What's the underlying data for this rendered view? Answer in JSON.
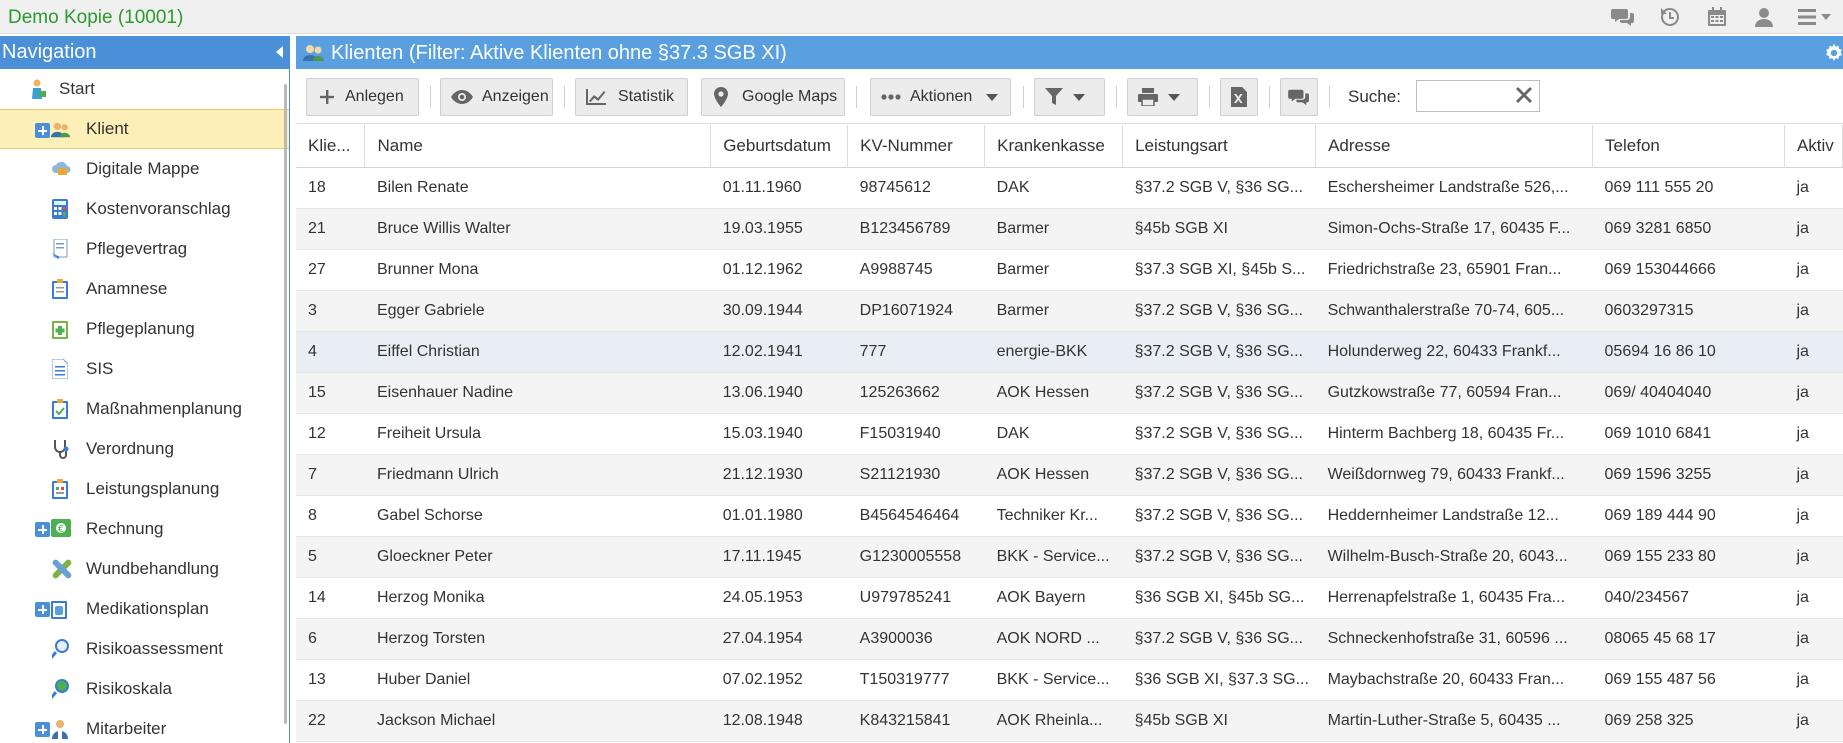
{
  "app": {
    "title": "Demo Kopie (10001)"
  },
  "top_icons": [
    "chat-icon",
    "history-icon",
    "calendar-icon",
    "user-icon",
    "menu-icon"
  ],
  "sidebar": {
    "title": "Navigation",
    "items": [
      {
        "label": "Start",
        "icon": "start-icon",
        "expandable": false,
        "active": false,
        "level": 0
      },
      {
        "label": "Klient",
        "icon": "clients-icon",
        "expandable": true,
        "active": true,
        "level": 0
      },
      {
        "label": "Digitale Mappe",
        "icon": "cloud-folder-icon",
        "expandable": false,
        "active": false,
        "level": 1
      },
      {
        "label": "Kostenvoranschlag",
        "icon": "calculator-icon",
        "expandable": false,
        "active": false,
        "level": 1
      },
      {
        "label": "Pflegevertrag",
        "icon": "contract-icon",
        "expandable": false,
        "active": false,
        "level": 1
      },
      {
        "label": "Anamnese",
        "icon": "clipboard-icon",
        "expandable": false,
        "active": false,
        "level": 1
      },
      {
        "label": "Pflegeplanung",
        "icon": "care-plan-icon",
        "expandable": false,
        "active": false,
        "level": 1
      },
      {
        "label": "SIS",
        "icon": "document-icon",
        "expandable": false,
        "active": false,
        "level": 1
      },
      {
        "label": "Maßnahmenplanung",
        "icon": "measures-icon",
        "expandable": false,
        "active": false,
        "level": 1
      },
      {
        "label": "Verordnung",
        "icon": "stethoscope-icon",
        "expandable": false,
        "active": false,
        "level": 1
      },
      {
        "label": "Leistungsplanung",
        "icon": "service-plan-icon",
        "expandable": false,
        "active": false,
        "level": 1
      },
      {
        "label": "Rechnung",
        "icon": "invoice-icon",
        "expandable": true,
        "active": false,
        "level": 0
      },
      {
        "label": "Wundbehandlung",
        "icon": "bandage-icon",
        "expandable": false,
        "active": false,
        "level": 1
      },
      {
        "label": "Medikationsplan",
        "icon": "medication-icon",
        "expandable": true,
        "active": false,
        "level": 0
      },
      {
        "label": "Risikoassessment",
        "icon": "risk-magnifier-icon",
        "expandable": false,
        "active": false,
        "level": 1
      },
      {
        "label": "Risikoskala",
        "icon": "risk-scale-icon",
        "expandable": false,
        "active": false,
        "level": 1
      },
      {
        "label": "Mitarbeiter",
        "icon": "employee-icon",
        "expandable": true,
        "active": false,
        "level": 0
      }
    ]
  },
  "main": {
    "title": "Klienten (Filter: Aktive Klienten ohne §37.3 SGB XI)"
  },
  "toolbar": {
    "add_label": "Anlegen",
    "view_label": "Anzeigen",
    "stats_label": "Statistik",
    "maps_label": "Google Maps",
    "actions_label": "Aktionen",
    "search_label": "Suche:",
    "search_value": ""
  },
  "table": {
    "columns": [
      "Klie...",
      "Name",
      "Geburtsdatum",
      "KV-Nummer",
      "Krankenkasse",
      "Leistungsart",
      "Adresse",
      "Telefon",
      "Aktiv"
    ],
    "rows": [
      [
        "18",
        "Bilen Renate",
        "01.11.1960",
        "98745612",
        "DAK",
        "§37.2 SGB V, §36 SG...",
        "Eschersheimer Landstraße 526,...",
        "069 111 555 20",
        "ja"
      ],
      [
        "21",
        "Bruce Willis Walter",
        "19.03.1955",
        "B123456789",
        "Barmer",
        "§45b SGB XI",
        "Simon-Ochs-Straße 17, 60435 F...",
        "069 3281 6850",
        "ja"
      ],
      [
        "27",
        "Brunner Mona",
        "01.12.1962",
        "A9988745",
        "Barmer",
        "§37.3 SGB XI, §45b S...",
        "Friedrichstraße 23, 65901 Fran...",
        "069 153044666",
        "ja"
      ],
      [
        "3",
        "Egger Gabriele",
        "30.09.1944",
        "DP16071924",
        "Barmer",
        "§37.2 SGB V, §36 SG...",
        "Schwanthalerstraße 70-74, 605...",
        "0603297315",
        "ja"
      ],
      [
        "4",
        "Eiffel Christian",
        "12.02.1941",
        "777",
        "energie-BKK",
        "§37.2 SGB V, §36 SG...",
        "Holunderweg 22, 60433 Frankf...",
        "05694 16 86 10",
        "ja"
      ],
      [
        "15",
        "Eisenhauer Nadine",
        "13.06.1940",
        "125263662",
        "AOK Hessen",
        "§37.2 SGB V, §36 SG...",
        "Gutzkowstraße 77, 60594 Fran...",
        "069/ 40404040",
        "ja"
      ],
      [
        "12",
        "Freiheit Ursula",
        "15.03.1940",
        "F15031940",
        "DAK",
        "§37.2 SGB V, §36 SG...",
        "Hinterm Bachberg 18, 60435 Fr...",
        "069 1010 6841",
        "ja"
      ],
      [
        "7",
        "Friedmann Ulrich",
        "21.12.1930",
        "S21121930",
        "AOK Hessen",
        "§37.2 SGB V, §36 SG...",
        "Weißdornweg 79, 60433 Frankf...",
        "069 1596 3255",
        "ja"
      ],
      [
        "8",
        "Gabel Schorse",
        "01.01.1980",
        "B4564546464",
        "Techniker Kr...",
        "§37.2 SGB V, §36 SG...",
        "Heddernheimer Landstraße 12...",
        "069 189 444 90",
        "ja"
      ],
      [
        "5",
        "Gloeckner Peter",
        "17.11.1945",
        "G1230005558",
        "BKK - Service...",
        "§37.2 SGB V, §36 SG...",
        "Wilhelm-Busch-Straße 20, 6043...",
        "069 155 233 80",
        "ja"
      ],
      [
        "14",
        "Herzog Monika",
        "24.05.1953",
        "U979785241",
        "AOK Bayern",
        "§36 SGB XI, §45b SG...",
        "Herrenapfelstraße 1, 60435 Fra...",
        "040/234567",
        "ja"
      ],
      [
        "6",
        "Herzog Torsten",
        "27.04.1954",
        "A3900036",
        "AOK NORD ...",
        "§37.2 SGB V, §36 SG...",
        "Schneckenhofstraße 31, 60596 ...",
        "08065 45 68 17",
        "ja"
      ],
      [
        "13",
        "Huber Daniel",
        "07.02.1952",
        "T150319777",
        "BKK - Service...",
        "§36 SGB XI, §37.3 SG...",
        "Maybachstraße 20, 60433 Fran...",
        "069 155 487 56",
        "ja"
      ],
      [
        "22",
        "Jackson Michael",
        "12.08.1948",
        "K843215841",
        "AOK Rheinla...",
        "§45b SGB XI",
        "Martin-Luther-Straße 5, 60435 ...",
        "069 258 325",
        "ja"
      ]
    ],
    "highlight_row": 4
  }
}
